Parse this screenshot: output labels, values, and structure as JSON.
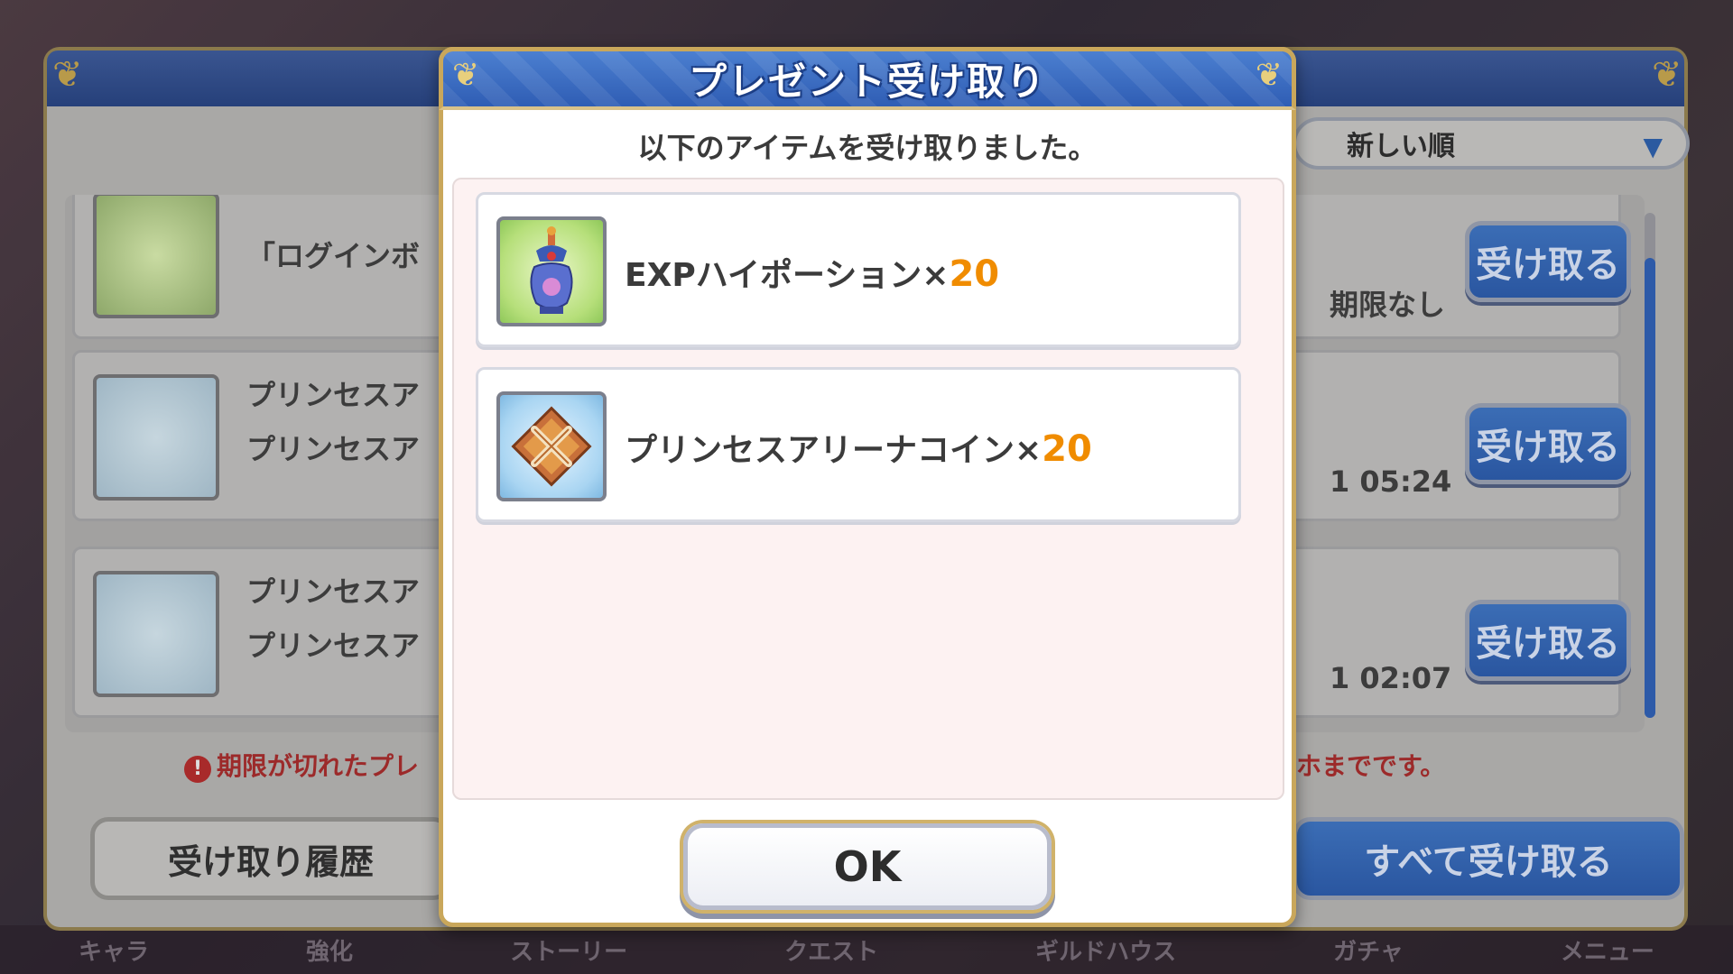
{
  "background_panel": {
    "sort_label": "新しい順",
    "rows": [
      {
        "line1": "「ログインボ",
        "right": "期限なし",
        "claim_label": "受け取る"
      },
      {
        "line1": "プリンセスア",
        "line2": "プリンセスア",
        "right": "1 05:24",
        "claim_label": "受け取る"
      },
      {
        "line1": "プリンセスア",
        "line2": "プリンセスア",
        "right": "1 02:07",
        "claim_label": "受け取る"
      }
    ],
    "notice_left": "期限が切れたプレ",
    "notice_right": "ホまでです。",
    "history_button": "受け取り履歴",
    "claim_all_button": "すべて受け取る"
  },
  "bottom_nav": [
    "キャラ",
    "強化",
    "ストーリー",
    "クエスト",
    "ギルドハウス",
    "ガチャ",
    "メニュー"
  ],
  "modal": {
    "title": "プレゼント受け取り",
    "subtitle": "以下のアイテムを受け取りました。",
    "items": [
      {
        "name": "EXPハイポーション×",
        "quantity": "20",
        "icon": "potion-icon"
      },
      {
        "name": "プリンセスアリーナコイン×",
        "quantity": "20",
        "icon": "arena-coin-icon"
      }
    ],
    "ok_label": "OK"
  },
  "colors": {
    "header_blue": "#2f5db4",
    "gold_border": "#c9a75b",
    "quantity_orange": "#f08c00"
  }
}
